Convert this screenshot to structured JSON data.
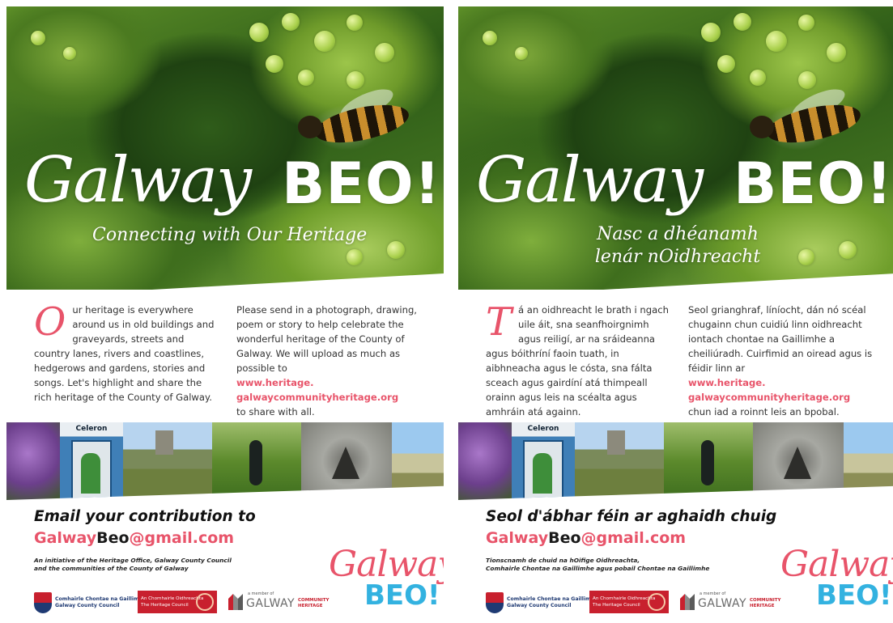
{
  "posters": [
    {
      "lang": "en",
      "title_script": "Galway",
      "title_bold": "BEO!",
      "tagline_lines": [
        "Connecting with Our Heritage"
      ],
      "left_col_dropcap": "O",
      "left_col_text": "ur heritage is everywhere around us in old buildings and graveyards, streets and country lanes, rivers and coastlines, hedgerows and gardens, stories and songs. Let's highlight and share the rich heritage of the County of Galway.",
      "right_col_text": "Please send in a photograph, drawing, poem or story to help celebrate the wonderful heritage of the County of Galway. We will upload as much as possible to",
      "link_line1": "www.heritage.",
      "link_line2": "galwaycommunityheritage.org",
      "right_col_after": "to share with all.",
      "photo_sign": "Celeron",
      "email_heading": "Email your contribution to",
      "email_part1": "Galway",
      "email_part2": "Beo",
      "email_part3": "@gmail.com",
      "initiative_line1": "An initiative of the Heritage Office, Galway County Council",
      "initiative_line2": "and the communities of the County of Galway",
      "logo_script": "Galway",
      "logo_bold": "BEO!"
    },
    {
      "lang": "ga",
      "title_script": "Galway",
      "title_bold": "BEO!",
      "tagline_lines": [
        "Nasc a dhéanamh",
        "lenár nOidhreacht"
      ],
      "left_col_dropcap": "T",
      "left_col_text": "á an oidhreacht le brath i ngach uile áit, sna seanfhoirgnimh agus reiligí, ar na sráideanna agus bóithríní faoin tuath, in aibhneacha agus le cósta, sna fálta sceach agus gairdíní atá thimpeall orainn agus leis na scéalta agus amhráin atá againn.",
      "right_col_text": "Seol grianghraf, líníocht, dán nó scéal chugainn chun cuidiú linn oidhreacht iontach chontae na Gaillimhe a cheiliúradh. Cuirfimid an oiread agus is féidir linn ar",
      "link_line1": "www.heritage.",
      "link_line2": "galwaycommunityheritage.org",
      "right_col_after": "chun iad a roinnt leis an bpobal.",
      "photo_sign": "Celeron",
      "email_heading": "Seol d'ábhar féin ar aghaidh chuig",
      "email_part1": "Galway",
      "email_part2": "Beo",
      "email_part3": "@gmail.com",
      "initiative_line1": "Tionscnamh de chuid na hOifige Oidhreachta,",
      "initiative_line2": "Comhairle Chontae na Gaillimhe agus pobail Chontae na Gaillimhe",
      "logo_script": "Galway",
      "logo_bold": "BEO!"
    }
  ],
  "partners": {
    "council_line1": "Comhairle Chontae na Gaillimhe",
    "council_line2": "Galway County Council",
    "heritage_line1": "An Chomhairle Oidhreachta",
    "heritage_line2": "The Heritage Council",
    "community_member": "a member of",
    "community_galway": "GALWAY",
    "community_line1": "COMMUNITY",
    "community_line2": "HERITAGE"
  },
  "colors": {
    "accent_pink": "#e8546a",
    "accent_blue": "#33b2e0",
    "council_red": "#c8202e"
  }
}
